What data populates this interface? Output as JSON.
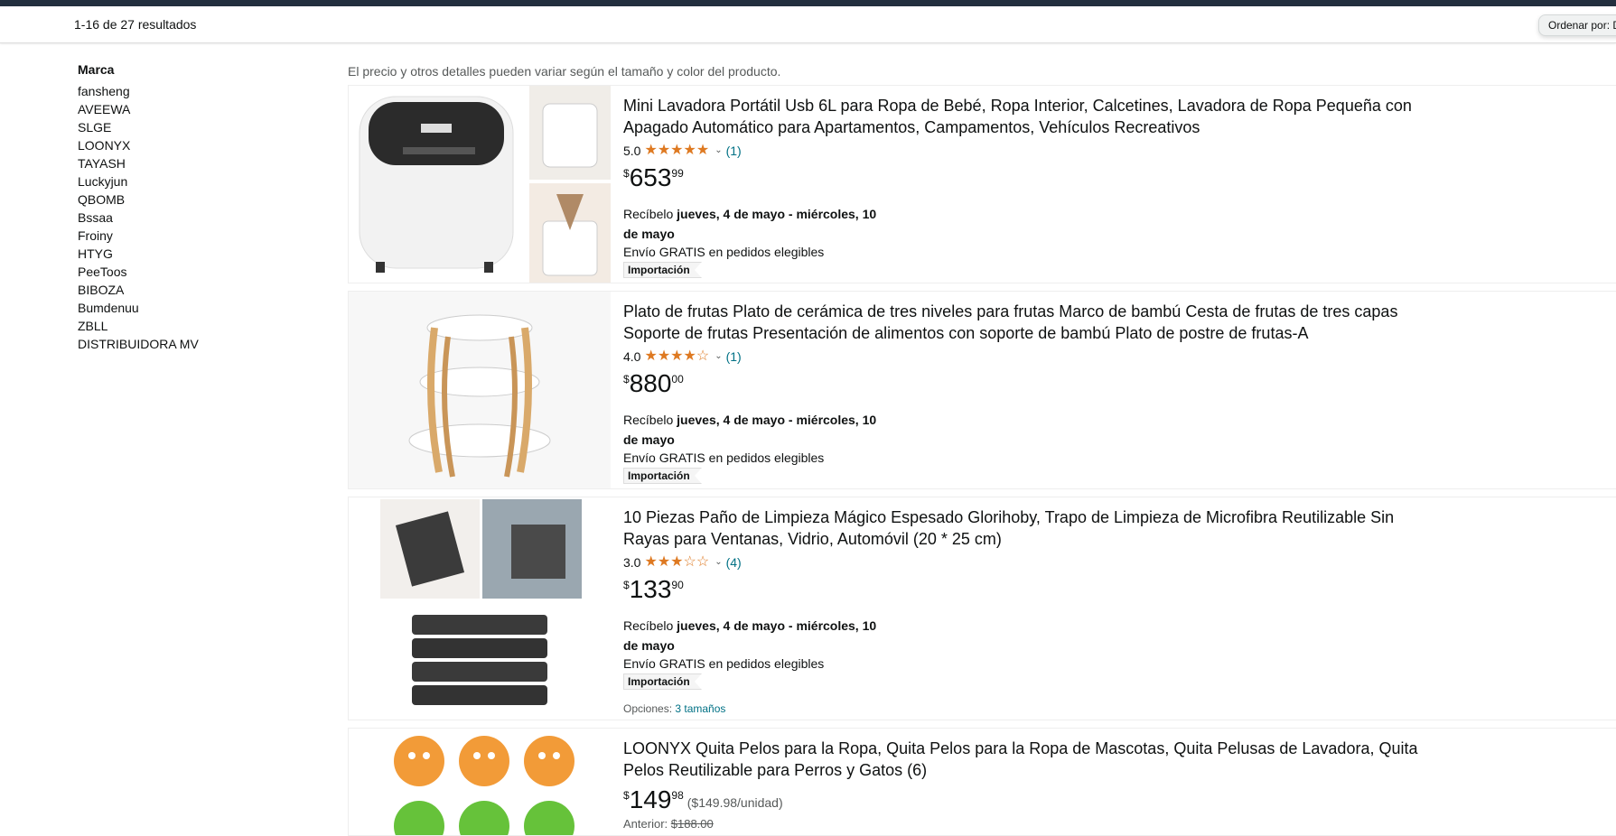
{
  "results": {
    "count_text": "1-16 de 27 resultados",
    "sort_label": "Ordenar por:  Destacados"
  },
  "sidebar": {
    "heading": "Marca",
    "brands": [
      "fansheng",
      "AVEEWA",
      "SLGE",
      "LOONYX",
      "TAYASH",
      "Luckyjun",
      "QBOMB",
      "Bssaa",
      "Froiny",
      "HTYG",
      "PeeToos",
      "BIBOZA",
      "Bumdenuu",
      "ZBLL",
      "DISTRIBUIDORA MV"
    ]
  },
  "notice": "El precio y otros detalles pueden variar según el tamaño y color del producto.",
  "products": [
    {
      "title": "Mini Lavadora Portátil Usb 6L para Ropa de Bebé, Ropa Interior, Calcetines, Lavadora de Ropa Pequeña con Apagado Automático para Apartamentos, Campamentos, Vehículos Recreativos",
      "rating": "5.0",
      "stars": "★★★★★",
      "reviews": "(1)",
      "price_symbol": "$",
      "price_whole": "653",
      "price_fraction": "99",
      "delivery_prefix": "Recíbelo ",
      "delivery_date": "jueves, 4 de mayo - miércoles, 10 de mayo",
      "shipping": "Envío GRATIS en pedidos elegibles",
      "badge": "Importación"
    },
    {
      "title": "Plato de frutas Plato de cerámica de tres niveles para frutas Marco de bambú Cesta de frutas de tres capas Soporte de frutas Presentación de alimentos con soporte de bambú Plato de postre de frutas-A",
      "rating": "4.0",
      "stars": "★★★★☆",
      "reviews": "(1)",
      "price_symbol": "$",
      "price_whole": "880",
      "price_fraction": "00",
      "delivery_prefix": "Recíbelo ",
      "delivery_date": "jueves, 4 de mayo - miércoles, 10 de mayo",
      "shipping": "Envío GRATIS en pedidos elegibles",
      "badge": "Importación"
    },
    {
      "title": "10 Piezas Paño de Limpieza Mágico Espesado Glorihoby, Trapo de Limpieza de Microfibra Reutilizable Sin Rayas para Ventanas, Vidrio, Automóvil (20 * 25 cm)",
      "rating": "3.0",
      "stars": "★★★☆☆",
      "reviews": "(4)",
      "price_symbol": "$",
      "price_whole": "133",
      "price_fraction": "90",
      "delivery_prefix": "Recíbelo ",
      "delivery_date": "jueves, 4 de mayo - miércoles, 10 de mayo",
      "shipping": "Envío GRATIS en pedidos elegibles",
      "badge": "Importación",
      "options_label": "Opciones: ",
      "options_link": "3 tamaños"
    },
    {
      "title": "LOONYX Quita Pelos para la Ropa, Quita Pelos para la Ropa de Mascotas, Quita Pelusas de Lavadora, Quita Pelos Reutilizable para Perros y Gatos (6)",
      "price_symbol": "$",
      "price_whole": "149",
      "price_fraction": "98",
      "unit_price": "($149.98/unidad)",
      "prev_label": "Anterior: ",
      "prev_price": "$188.00"
    }
  ]
}
